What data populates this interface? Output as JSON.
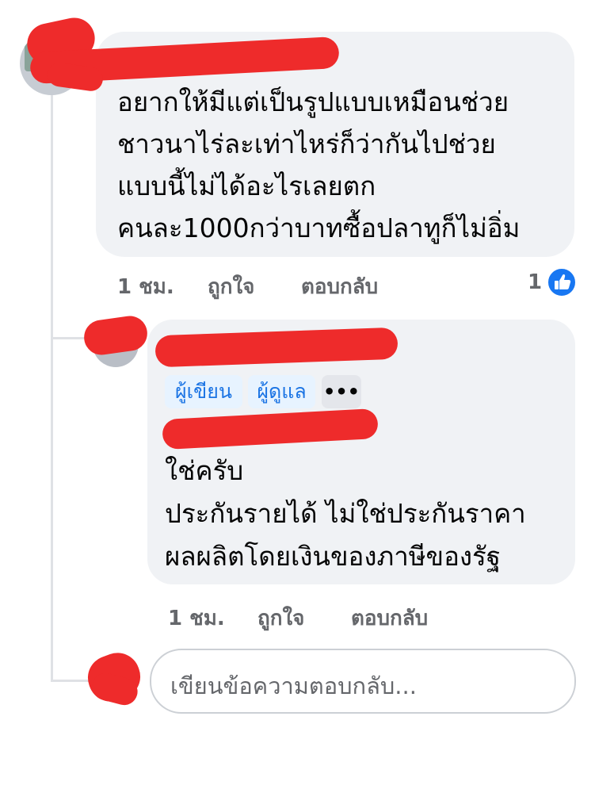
{
  "comment": {
    "lines": [
      "อยากให้มีแต่เป็นรูปแบบเหมือนช่วย",
      "ชาวนาไร่ละเท่าไหร่ก็ว่ากันไปช่วย",
      "แบบนี้ไม่ได้อะไรเลยตก",
      "คนละ1000กว่าบาทซื้อปลาทูก็ไม่อิ่ม"
    ],
    "time": "1 ชม.",
    "like_label": "ถูกใจ",
    "reply_label": "ตอบกลับ",
    "reaction_count": "1",
    "reaction_icon": "like-thumb-icon"
  },
  "reply": {
    "badges": [
      "ผู้เขียน",
      "ผู้ดูแล"
    ],
    "more_label": "•••",
    "lines": [
      "ใช่ครับ",
      "ประกันรายได้ ไม่ใช่ประกันราคา",
      "ผลผลิตโดยเงินของภาษีของรัฐ"
    ],
    "time": "1 ชม.",
    "like_label": "ถูกใจ",
    "reply_label": "ตอบกลับ"
  },
  "composer": {
    "placeholder": "เขียนข้อความตอบกลับ..."
  },
  "colors": {
    "redaction": "#ee2b2b",
    "bubble": "#f0f2f5",
    "accent": "#1877f2"
  }
}
